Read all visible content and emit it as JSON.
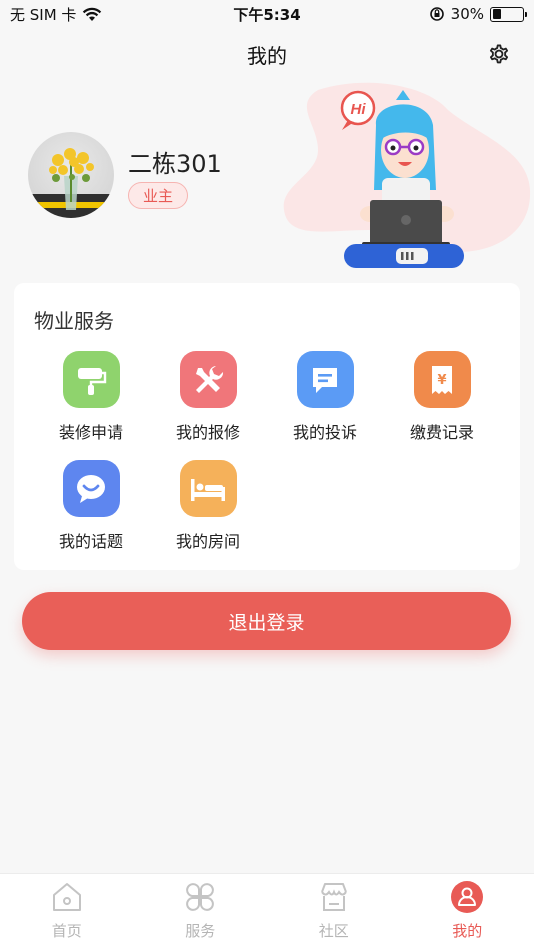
{
  "status_bar": {
    "carrier": "无 SIM 卡",
    "time": "下午5:34",
    "battery_percent": "30%",
    "battery_level": 0.3
  },
  "nav": {
    "title": "我的"
  },
  "profile": {
    "name": "二栋301",
    "role": "业主",
    "speech_bubble": "Hi"
  },
  "services": {
    "title": "物业服务",
    "items": [
      {
        "label": "装修申请",
        "icon": "paint-roller-icon",
        "color": "#8fd36d"
      },
      {
        "label": "我的报修",
        "icon": "wrench-screwdriver-icon",
        "color": "#f0767a"
      },
      {
        "label": "我的投诉",
        "icon": "message-lines-icon",
        "color": "#5b9bf5"
      },
      {
        "label": "缴费记录",
        "icon": "receipt-yen-icon",
        "color": "#f08a4b"
      },
      {
        "label": "我的话题",
        "icon": "chat-smile-icon",
        "color": "#5e86ef"
      },
      {
        "label": "我的房间",
        "icon": "bed-icon",
        "color": "#f5b15a"
      }
    ]
  },
  "logout": {
    "label": "退出登录",
    "color": "#e95f58"
  },
  "tab_bar": {
    "tabs": [
      {
        "label": "首页",
        "icon": "home-icon",
        "active": false
      },
      {
        "label": "服务",
        "icon": "grid-flower-icon",
        "active": false
      },
      {
        "label": "社区",
        "icon": "shop-icon",
        "active": false
      },
      {
        "label": "我的",
        "icon": "user-icon",
        "active": true
      }
    ],
    "active_color": "#e85a55",
    "inactive_color": "#b5b5b5"
  }
}
